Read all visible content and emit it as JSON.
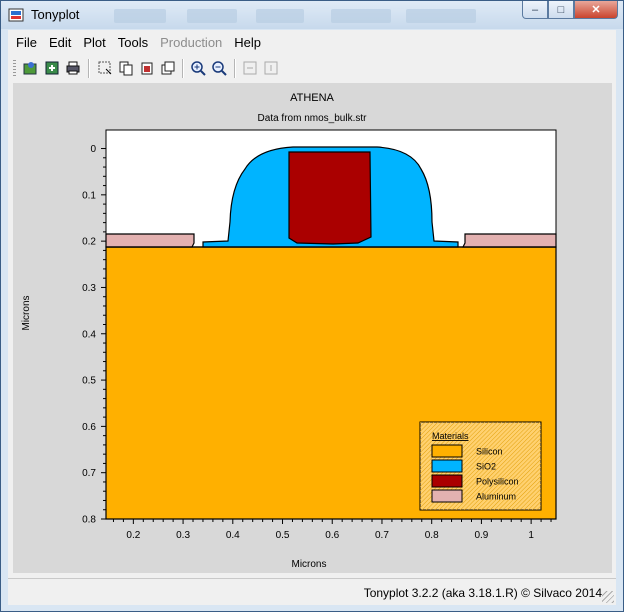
{
  "window": {
    "title": "Tonyplot",
    "controls": {
      "minimize": "–",
      "maximize": "□",
      "close": "✕"
    }
  },
  "menu": {
    "items": [
      {
        "label": "File",
        "enabled": true
      },
      {
        "label": "Edit",
        "enabled": true
      },
      {
        "label": "Plot",
        "enabled": true
      },
      {
        "label": "Tools",
        "enabled": true
      },
      {
        "label": "Production",
        "enabled": false
      },
      {
        "label": "Help",
        "enabled": true
      }
    ]
  },
  "toolbar": {
    "buttons": [
      "open-icon",
      "save-icon",
      "print-icon",
      "select-icon",
      "copy-icon",
      "paste-icon",
      "duplicate-icon",
      "zoom-in-icon",
      "zoom-out-icon",
      "redraw-icon",
      "reset-icon"
    ]
  },
  "plot": {
    "title": "ATHENA",
    "subtitle": "Data from nmos_bulk.str",
    "xlabel": "Microns",
    "ylabel": "Microns",
    "xticks": [
      "0.2",
      "0.3",
      "0.4",
      "0.5",
      "0.6",
      "0.7",
      "0.8",
      "0.9",
      "1"
    ],
    "yticks": [
      "0",
      "0.1",
      "0.2",
      "0.3",
      "0.4",
      "0.5",
      "0.6",
      "0.7",
      "0.8"
    ],
    "xlim": [
      0.145,
      1.05
    ],
    "ylim": [
      -0.04,
      0.8
    ],
    "legend": {
      "title": "Materials",
      "position": "bottom-right",
      "entries": [
        {
          "label": "Silicon",
          "color": "#ffb000"
        },
        {
          "label": "SiO2",
          "color": "#00b4ff"
        },
        {
          "label": "Polysilicon",
          "color": "#aa0000"
        },
        {
          "label": "Aluminum",
          "color": "#e3b1b0"
        }
      ]
    },
    "colors": {
      "background": "#ffffff",
      "panel": "#d8d8d8",
      "outline": "#000000"
    }
  },
  "status": {
    "text": "Tonyplot 3.2.2 (aka 3.18.1.R) © Silvaco 2014"
  }
}
